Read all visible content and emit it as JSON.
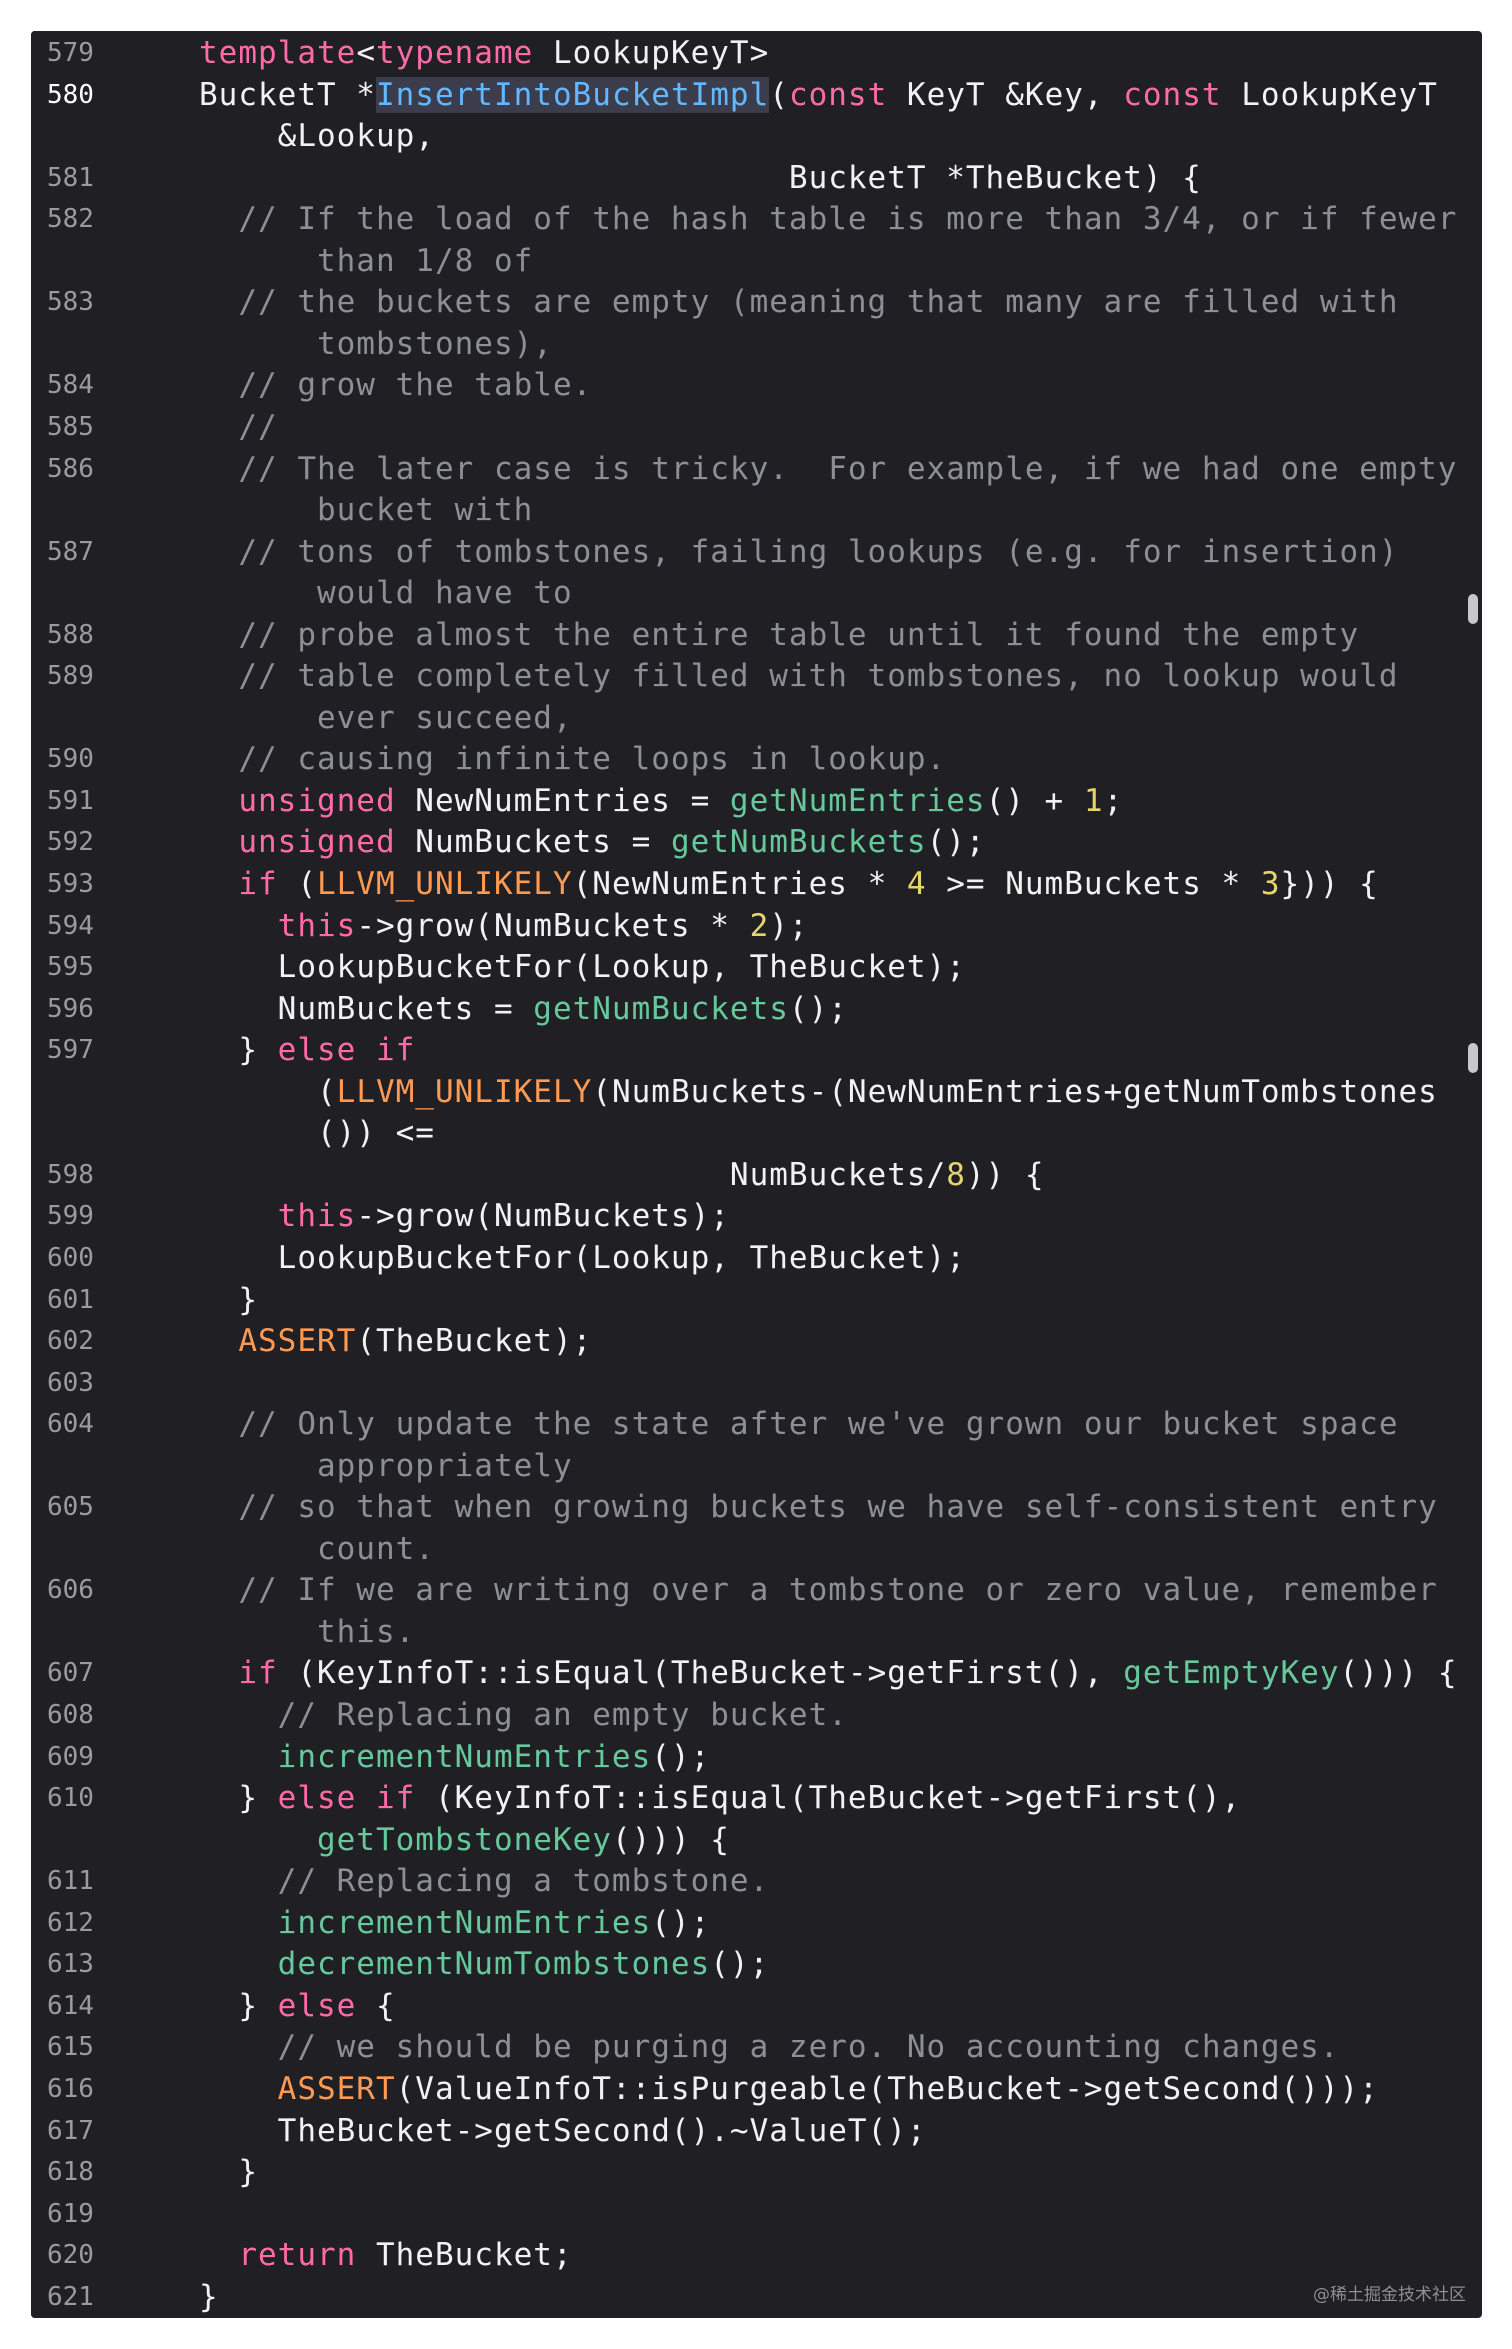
{
  "editor": {
    "current_line": "580",
    "lines": [
      {
        "n": "579",
        "t": [
          [
            "kw",
            "template"
          ],
          [
            "",
            "<"
          ],
          [
            "kw",
            "typename"
          ],
          [
            "",
            " LookupKeyT>"
          ]
        ]
      },
      {
        "n": "580",
        "t": [
          [
            "",
            "BucketT *"
          ],
          [
            "sel",
            "InsertIntoBucketImpl"
          ],
          [
            "",
            "("
          ],
          [
            "kw",
            "const"
          ],
          [
            "",
            " KeyT &Key, "
          ],
          [
            "kw",
            "const"
          ],
          [
            "",
            " LookupKeyT"
          ]
        ]
      },
      {
        "n": "",
        "t": [
          [
            "",
            "    &Lookup,"
          ]
        ]
      },
      {
        "n": "581",
        "t": [
          [
            "",
            "                              BucketT *TheBucket) {"
          ]
        ]
      },
      {
        "n": "582",
        "t": [
          [
            "cmt",
            "  // If the load of the hash table is more than 3/4, or if fewer"
          ]
        ]
      },
      {
        "n": "",
        "t": [
          [
            "cmt",
            "      than 1/8 of"
          ]
        ]
      },
      {
        "n": "583",
        "t": [
          [
            "cmt",
            "  // the buckets are empty (meaning that many are filled with"
          ]
        ]
      },
      {
        "n": "",
        "t": [
          [
            "cmt",
            "      tombstones),"
          ]
        ]
      },
      {
        "n": "584",
        "t": [
          [
            "cmt",
            "  // grow the table."
          ]
        ]
      },
      {
        "n": "585",
        "t": [
          [
            "cmt",
            "  //"
          ]
        ]
      },
      {
        "n": "586",
        "t": [
          [
            "cmt",
            "  // The later case is tricky.  For example, if we had one empty"
          ]
        ]
      },
      {
        "n": "",
        "t": [
          [
            "cmt",
            "      bucket with"
          ]
        ]
      },
      {
        "n": "587",
        "t": [
          [
            "cmt",
            "  // tons of tombstones, failing lookups (e.g. for insertion)"
          ]
        ]
      },
      {
        "n": "",
        "t": [
          [
            "cmt",
            "      would have to"
          ]
        ]
      },
      {
        "n": "588",
        "t": [
          [
            "cmt",
            "  // probe almost the entire table until it found the empty"
          ]
        ]
      },
      {
        "n": "589",
        "t": [
          [
            "cmt",
            "  // table completely filled with tombstones, no lookup would"
          ]
        ]
      },
      {
        "n": "",
        "t": [
          [
            "cmt",
            "      ever succeed,"
          ]
        ]
      },
      {
        "n": "590",
        "t": [
          [
            "cmt",
            "  // causing infinite loops in lookup."
          ]
        ]
      },
      {
        "n": "591",
        "t": [
          [
            "",
            "  "
          ],
          [
            "kw",
            "unsigned"
          ],
          [
            "",
            " NewNumEntries = "
          ],
          [
            "fn",
            "getNumEntries"
          ],
          [
            "",
            "() + "
          ],
          [
            "num",
            "1"
          ],
          [
            "",
            ";"
          ]
        ]
      },
      {
        "n": "592",
        "t": [
          [
            "",
            "  "
          ],
          [
            "kw",
            "unsigned"
          ],
          [
            "",
            " NumBuckets = "
          ],
          [
            "fn",
            "getNumBuckets"
          ],
          [
            "",
            "();"
          ]
        ]
      },
      {
        "n": "593",
        "t": [
          [
            "",
            "  "
          ],
          [
            "kw",
            "if"
          ],
          [
            "",
            " ("
          ],
          [
            "mac",
            "LLVM_UNLIKELY"
          ],
          [
            "",
            "(NewNumEntries * "
          ],
          [
            "num",
            "4"
          ],
          [
            "",
            " >= NumBuckets * "
          ],
          [
            "num",
            "3"
          ],
          [
            "",
            "})) {"
          ]
        ]
      },
      {
        "n": "594",
        "t": [
          [
            "",
            "    "
          ],
          [
            "kw",
            "this"
          ],
          [
            "",
            "->grow(NumBuckets * "
          ],
          [
            "num",
            "2"
          ],
          [
            "",
            ");"
          ]
        ]
      },
      {
        "n": "595",
        "t": [
          [
            "",
            "    LookupBucketFor(Lookup, TheBucket);"
          ]
        ]
      },
      {
        "n": "596",
        "t": [
          [
            "",
            "    NumBuckets = "
          ],
          [
            "fn",
            "getNumBuckets"
          ],
          [
            "",
            "();"
          ]
        ]
      },
      {
        "n": "597",
        "t": [
          [
            "",
            "  } "
          ],
          [
            "kw",
            "else if"
          ]
        ]
      },
      {
        "n": "",
        "t": [
          [
            "",
            "      ("
          ],
          [
            "mac",
            "LLVM_UNLIKELY"
          ],
          [
            "",
            "(NumBuckets-(NewNumEntries+getNumTombstones"
          ]
        ]
      },
      {
        "n": "",
        "t": [
          [
            "",
            "      ()) <="
          ]
        ]
      },
      {
        "n": "598",
        "t": [
          [
            "",
            "                           NumBuckets/"
          ],
          [
            "num",
            "8"
          ],
          [
            "",
            ")) {"
          ]
        ]
      },
      {
        "n": "599",
        "t": [
          [
            "",
            "    "
          ],
          [
            "kw",
            "this"
          ],
          [
            "",
            "->grow(NumBuckets);"
          ]
        ]
      },
      {
        "n": "600",
        "t": [
          [
            "",
            "    LookupBucketFor(Lookup, TheBucket);"
          ]
        ]
      },
      {
        "n": "601",
        "t": [
          [
            "",
            "  }"
          ]
        ]
      },
      {
        "n": "602",
        "t": [
          [
            "",
            "  "
          ],
          [
            "mac",
            "ASSERT"
          ],
          [
            "",
            "(TheBucket);"
          ]
        ]
      },
      {
        "n": "603",
        "t": [
          [
            "",
            ""
          ]
        ]
      },
      {
        "n": "604",
        "t": [
          [
            "cmt",
            "  // Only update the state after we've grown our bucket space"
          ]
        ]
      },
      {
        "n": "",
        "t": [
          [
            "cmt",
            "      appropriately"
          ]
        ]
      },
      {
        "n": "605",
        "t": [
          [
            "cmt",
            "  // so that when growing buckets we have self-consistent entry"
          ]
        ]
      },
      {
        "n": "",
        "t": [
          [
            "cmt",
            "      count."
          ]
        ]
      },
      {
        "n": "606",
        "t": [
          [
            "cmt",
            "  // If we are writing over a tombstone or zero value, remember"
          ]
        ]
      },
      {
        "n": "",
        "t": [
          [
            "cmt",
            "      this."
          ]
        ]
      },
      {
        "n": "607",
        "t": [
          [
            "",
            "  "
          ],
          [
            "kw",
            "if"
          ],
          [
            "",
            " (KeyInfoT::isEqual(TheBucket->getFirst(), "
          ],
          [
            "fn",
            "getEmptyKey"
          ],
          [
            "",
            "())) {"
          ]
        ]
      },
      {
        "n": "608",
        "t": [
          [
            "cmt",
            "    // Replacing an empty bucket."
          ]
        ]
      },
      {
        "n": "609",
        "t": [
          [
            "",
            "    "
          ],
          [
            "fn",
            "incrementNumEntries"
          ],
          [
            "",
            "();"
          ]
        ]
      },
      {
        "n": "610",
        "t": [
          [
            "",
            "  } "
          ],
          [
            "kw",
            "else if"
          ],
          [
            "",
            " (KeyInfoT::isEqual(TheBucket->getFirst(),"
          ]
        ]
      },
      {
        "n": "",
        "t": [
          [
            "",
            "      "
          ],
          [
            "fn",
            "getTombstoneKey"
          ],
          [
            "",
            "())) {"
          ]
        ]
      },
      {
        "n": "611",
        "t": [
          [
            "cmt",
            "    // Replacing a tombstone."
          ]
        ]
      },
      {
        "n": "612",
        "t": [
          [
            "",
            "    "
          ],
          [
            "fn",
            "incrementNumEntries"
          ],
          [
            "",
            "();"
          ]
        ]
      },
      {
        "n": "613",
        "t": [
          [
            "",
            "    "
          ],
          [
            "fn",
            "decrementNumTombstones"
          ],
          [
            "",
            "();"
          ]
        ]
      },
      {
        "n": "614",
        "t": [
          [
            "",
            "  } "
          ],
          [
            "kw",
            "else"
          ],
          [
            "",
            " {"
          ]
        ]
      },
      {
        "n": "615",
        "t": [
          [
            "cmt",
            "    // we should be purging a zero. No accounting changes."
          ]
        ]
      },
      {
        "n": "616",
        "t": [
          [
            "",
            "    "
          ],
          [
            "mac",
            "ASSERT"
          ],
          [
            "",
            "(ValueInfoT::isPurgeable(TheBucket->getSecond()));"
          ]
        ]
      },
      {
        "n": "617",
        "t": [
          [
            "",
            "    TheBucket->getSecond().~ValueT();"
          ]
        ]
      },
      {
        "n": "618",
        "t": [
          [
            "",
            "  }"
          ]
        ]
      },
      {
        "n": "619",
        "t": [
          [
            "",
            ""
          ]
        ]
      },
      {
        "n": "620",
        "t": [
          [
            "",
            "  "
          ],
          [
            "kw",
            "return"
          ],
          [
            "",
            " TheBucket;"
          ]
        ]
      },
      {
        "n": "621",
        "t": [
          [
            "",
            "}"
          ]
        ]
      }
    ]
  },
  "watermark": "@稀土掘金技术社区"
}
